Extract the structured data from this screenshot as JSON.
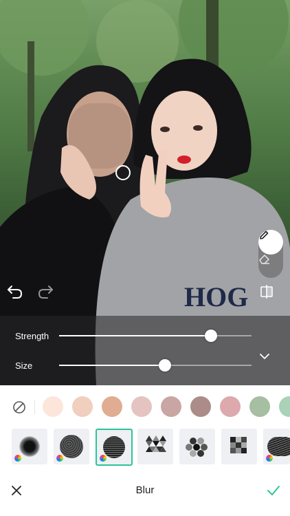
{
  "editor": {
    "strength_label": "Strength",
    "size_label": "Size",
    "strength_value": 0.79,
    "size_value": 0.55
  },
  "icons": {
    "undo": "undo-icon",
    "redo": "redo-icon",
    "brush": "pencil-icon",
    "eraser": "eraser-icon",
    "compare": "compare-icon",
    "collapse": "chevron-down-icon",
    "none": "no-color-icon",
    "close": "close-icon",
    "apply": "check-icon"
  },
  "colors": {
    "accent": "#2dc39a",
    "swatches": [
      "#fce6dc",
      "#f0cfbe",
      "#e0ac92",
      "#e5c3c1",
      "#c9a6a3",
      "#ab8c88",
      "#dca9ad",
      "#a6bea1",
      "#a9d2b6"
    ]
  },
  "patterns": [
    {
      "name": "soft-blur",
      "selected": false
    },
    {
      "name": "noise-blur",
      "selected": false
    },
    {
      "name": "line-blur",
      "selected": true
    },
    {
      "name": "triangle-mosaic",
      "selected": false
    },
    {
      "name": "hexagon-mosaic",
      "selected": false
    },
    {
      "name": "square-mosaic",
      "selected": false
    },
    {
      "name": "stroke-blur",
      "selected": false
    }
  ],
  "bottom": {
    "title": "Blur"
  }
}
